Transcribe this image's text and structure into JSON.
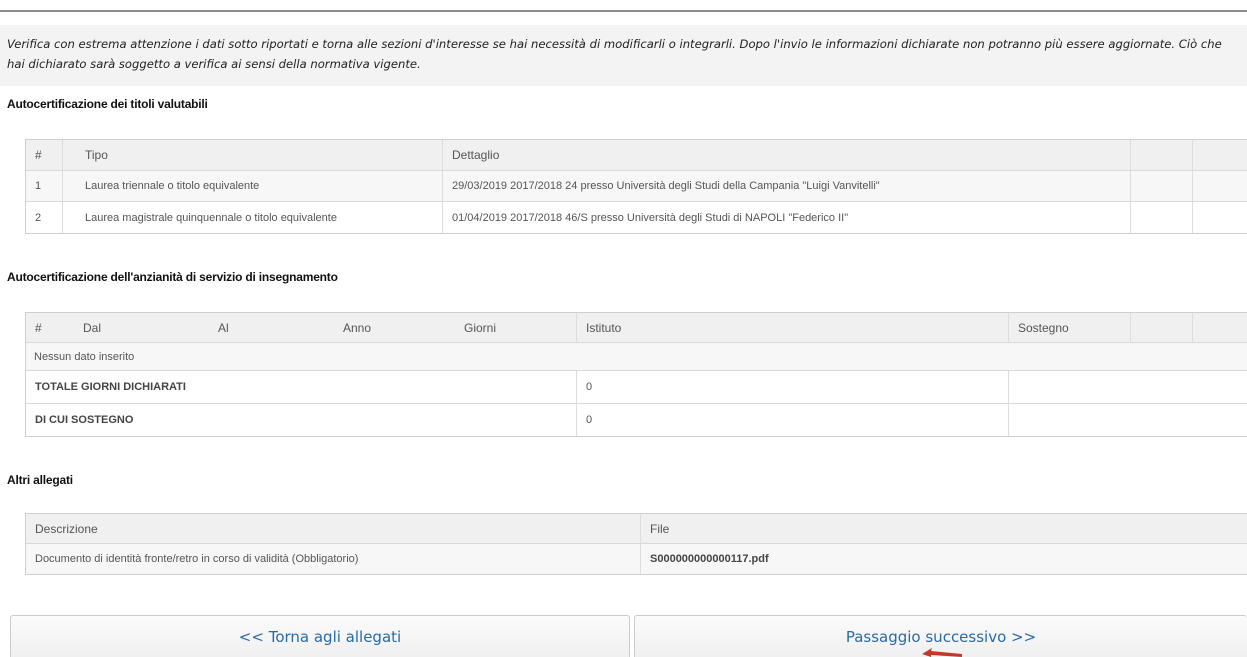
{
  "notice": {
    "text": "Verifica con estrema attenzione i dati sotto riportati e torna alle sezioni d'interesse se hai necessità di modificarli o integrarli. Dopo l'invio le informazioni dichiarate non potranno più essere aggiornate. Ciò che hai dichiarato sarà soggetto a verifica ai sensi della normativa vigente."
  },
  "titoli": {
    "title": "Autocertificazione dei titoli valutabili",
    "headers": {
      "num": "#",
      "tipo": "Tipo",
      "dettaglio": "Dettaglio"
    },
    "rows": [
      {
        "num": "1",
        "tipo": "Laurea triennale o titolo equivalente",
        "dettaglio": "29/03/2019 2017/2018 24 presso Università degli Studi della Campania \"Luigi Vanvitelli\""
      },
      {
        "num": "2",
        "tipo": "Laurea magistrale quinquennale o titolo equivalente",
        "dettaglio": "01/04/2019 2017/2018 46/S presso Università degli Studi di NAPOLI \"Federico II\""
      }
    ]
  },
  "servizio": {
    "title": "Autocertificazione dell'anzianità di servizio di insegnamento",
    "headers": {
      "num": "#",
      "dal": "Dal",
      "al": "Al",
      "anno": "Anno",
      "giorni": "Giorni",
      "istituto": "Istituto",
      "sostegno": "Sostegno"
    },
    "empty": "Nessun dato inserito",
    "totale_label": "TOTALE GIORNI DICHIARATI",
    "totale_value": "0",
    "sostegno_label": "DI CUI SOSTEGNO",
    "sostegno_value": "0"
  },
  "allegati": {
    "title": "Altri allegati",
    "headers": {
      "descrizione": "Descrizione",
      "file": "File"
    },
    "rows": [
      {
        "descrizione": "Documento di identità fronte/retro in corso di validità (Obbligatorio)",
        "file": "S000000000000117.pdf"
      }
    ]
  },
  "buttons": {
    "back": "<< Torna agli allegati",
    "next": "Passaggio successivo >>"
  },
  "colors": {
    "link": "#2a6aa8",
    "arrow": "#c0392b"
  }
}
